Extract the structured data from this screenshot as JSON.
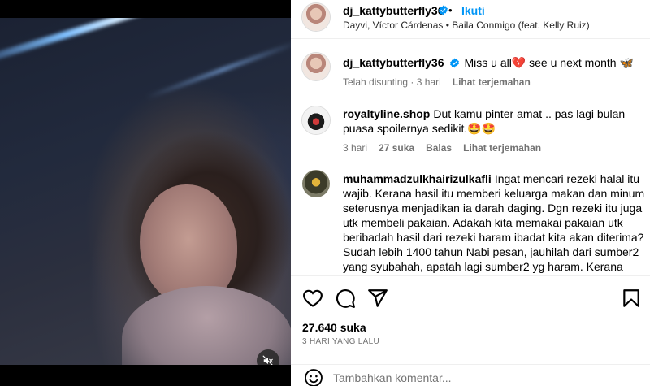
{
  "post": {
    "author": "dj_kattybutterfly36",
    "follow_label": "Ikuti",
    "separator": "•",
    "audio": "Dayvi, Víctor Cárdenas • Baila Conmigo (feat. Kelly Ruiz)",
    "caption": "Miss u all💔  see u next month 🦋",
    "caption_meta": {
      "edited": "Telah disunting · 3 hari",
      "translate": "Lihat terjemahan"
    }
  },
  "comments": [
    {
      "username": "royaltyline.shop",
      "text": "Dut kamu pinter amat .. pas lagi bulan puasa spoilernya sedikit.🤩🤩",
      "time": "3 hari",
      "likes": "27 suka",
      "reply": "Balas",
      "translate": "Lihat terjemahan"
    },
    {
      "username": "muhammadzulkhairizulkafli",
      "text": "Ingat mencari rezeki halal itu wajib. Kerana hasil itu memberi keluarga makan dan minum seterusnya menjadikan ia darah daging. Dgn rezeki itu juga utk membeli pakaian. Adakah kita memakai pakaian utk beribadah hasil dari rezeki haram ibadat kita akan diterima? Sudah lebih 1400 tahun Nabi pesan, jauhilah dari sumber2 yang syubahah, apatah lagi sumber2 yg haram. Kerana kelak ianya menjadi"
    }
  ],
  "stats": {
    "likes": "27.640 suka",
    "date": "3 HARI YANG LALU"
  },
  "composer": {
    "placeholder": "Tambahkan komentar..."
  },
  "icons": {
    "like": "heart-icon",
    "comment": "comment-icon",
    "share": "share-icon",
    "save": "bookmark-icon",
    "emoji": "emoji-icon",
    "mute": "muted-speaker-icon",
    "verified": "verified-badge-icon"
  },
  "colors": {
    "accent": "#0095f6",
    "verified": "#0095f6",
    "secondary_text": "#737373"
  }
}
